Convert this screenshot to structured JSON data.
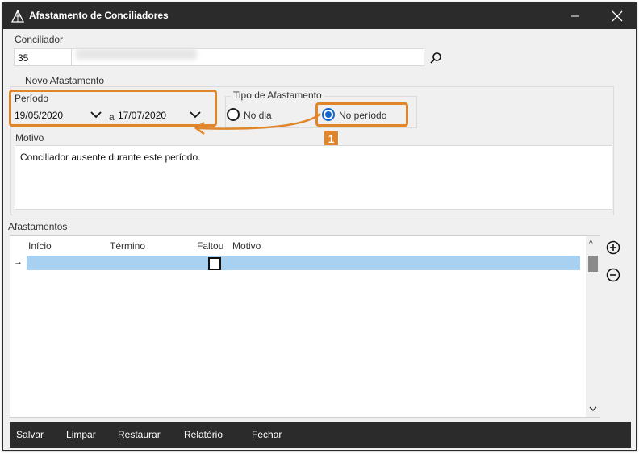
{
  "window": {
    "title": "Afastamento de Conciliadores"
  },
  "conciliador": {
    "label": "Conciliador",
    "code": "35"
  },
  "novo_afastamento": {
    "label": "Novo Afastamento",
    "periodo_label": "Período",
    "start_date": "19/05/2020",
    "separator": "a",
    "end_date": "17/07/2020"
  },
  "tipo": {
    "label": "Tipo de Afastamento",
    "options": [
      {
        "label": "No dia",
        "selected": false
      },
      {
        "label": "No período",
        "selected": true
      }
    ]
  },
  "motivo": {
    "label": "Motivo",
    "value": "Conciliador ausente durante este período."
  },
  "callout": {
    "number": "1"
  },
  "afastamentos": {
    "label": "Afastamentos",
    "columns": [
      "Início",
      "Término",
      "Faltou",
      "Motivo"
    ]
  },
  "footer": {
    "buttons": [
      "Salvar",
      "Limpar",
      "Restaurar",
      "Relatório",
      "Fechar"
    ]
  },
  "colors": {
    "accent_orange": "#e0852a",
    "selection_blue": "#a8d0f0",
    "titlebar": "#2b2b2b"
  }
}
